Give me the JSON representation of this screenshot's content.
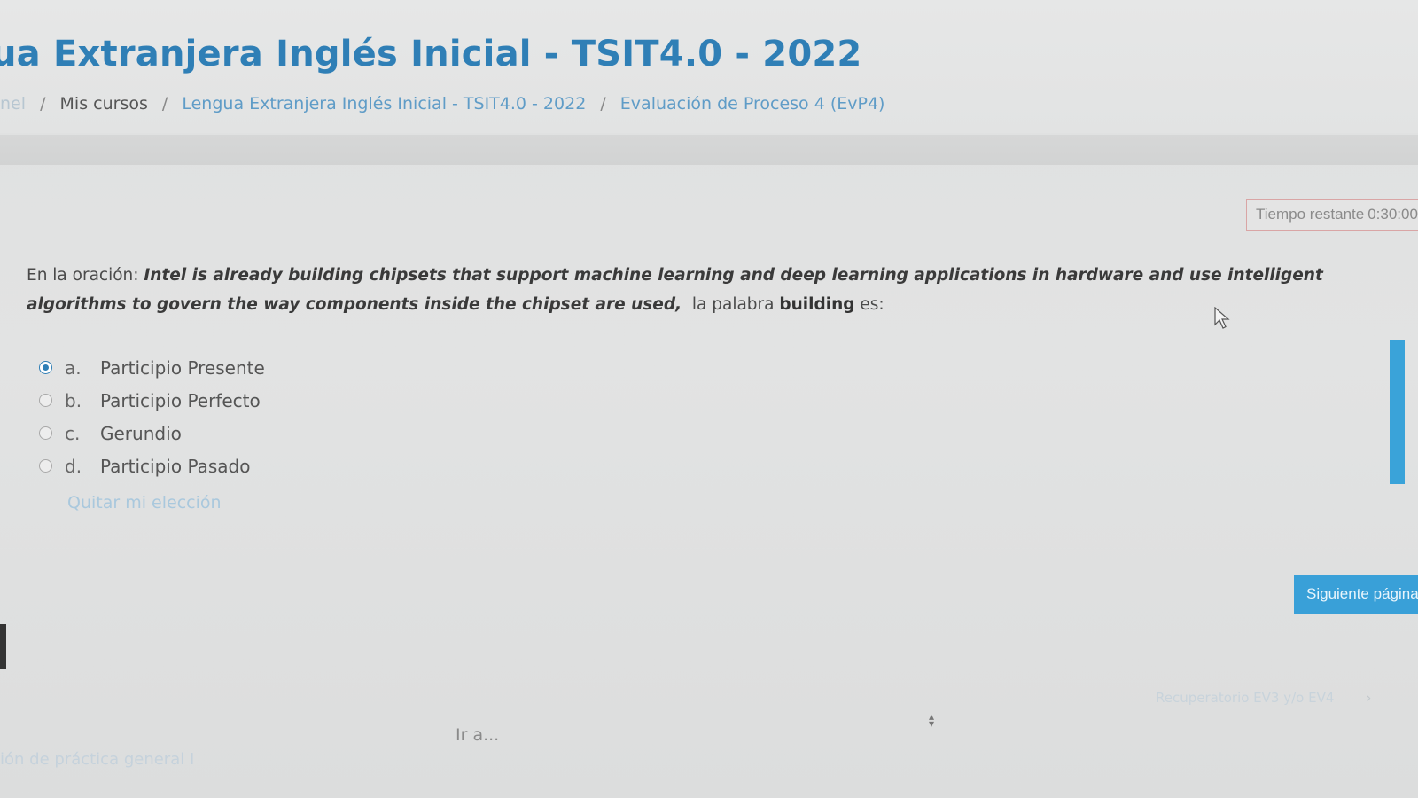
{
  "header": {
    "title": "ua Extranjera Inglés Inicial - TSIT4.0 - 2022",
    "breadcrumb": [
      {
        "label": "nel",
        "style": "faint"
      },
      {
        "label": "Mis cursos",
        "style": "dark"
      },
      {
        "label": "Lengua Extranjera Inglés Inicial - TSIT4.0 - 2022",
        "style": "link"
      },
      {
        "label": "Evaluación de Proceso 4 (EvP4)",
        "style": "link"
      }
    ]
  },
  "timer": {
    "label": "Tiempo restante",
    "value": "0:30:00"
  },
  "question": {
    "prefix": "En la oración:",
    "sentence": "Intel is already building chipsets that support machine learning and deep learning applications in hardware and use intelligent algorithms to govern the way components inside the chipset are used,",
    "middle": "la palabra",
    "word": "building",
    "suffix": "es:"
  },
  "answers": [
    {
      "letter": "a.",
      "text": "Participio Presente",
      "selected": true
    },
    {
      "letter": "b.",
      "text": "Participio Perfecto",
      "selected": false
    },
    {
      "letter": "c.",
      "text": "Gerundio",
      "selected": false
    },
    {
      "letter": "d.",
      "text": "Participio Pasado",
      "selected": false
    }
  ],
  "clear_choice": "Quitar mi elección",
  "next_button": "Siguiente página",
  "navigation": {
    "jump_placeholder": "Ir a...",
    "next_activity": "Recuperatorio EV3 y/o EV4",
    "next_chevron": "›",
    "prev_activity": "ión de práctica general I"
  },
  "colors": {
    "accent": "#2f7fb6",
    "button": "#39a0d8",
    "timer_border": "#d9a5a5"
  }
}
